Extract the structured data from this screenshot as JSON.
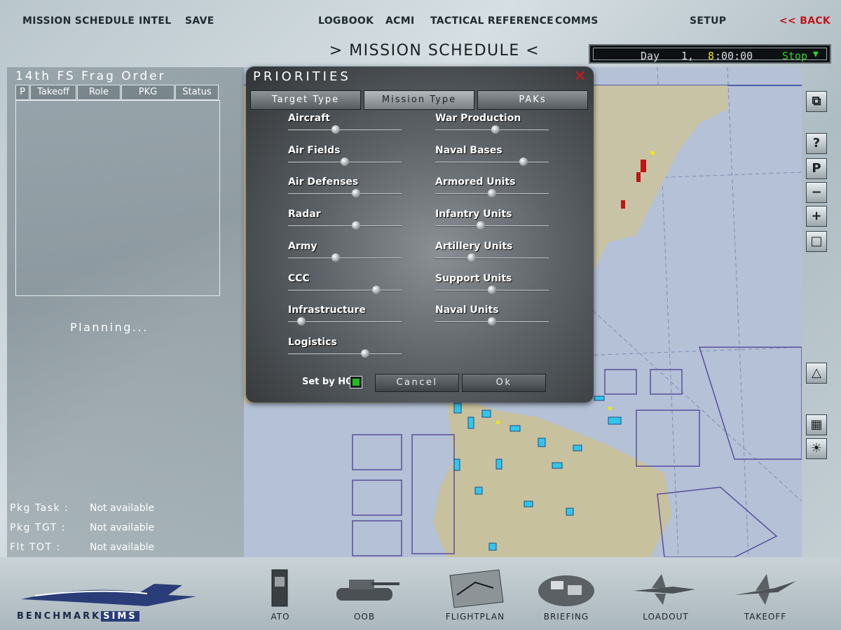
{
  "menu": {
    "mission_schedule": "MISSION SCHEDULE",
    "intel": "INTEL",
    "save": "SAVE",
    "logbook": "LOGBOOK",
    "acmi": "ACMI",
    "tactical_reference": "TACTICAL REFERENCE",
    "comms": "COMMS",
    "setup": "SETUP",
    "back": "<< BACK"
  },
  "page_title": "> MISSION SCHEDULE <",
  "clock": {
    "day_label": "Day",
    "day_value": "1,",
    "hour_digit": "8",
    "time_rest": ":00:00",
    "speed": "Stop"
  },
  "left_panel": {
    "title": "14th FS Frag Order",
    "columns": [
      "P",
      "Takeoff",
      "Role",
      "PKG",
      "Status"
    ],
    "planning_text": "Planning...",
    "info": [
      {
        "label": "Pkg Task :",
        "value": "Not available"
      },
      {
        "label": "Pkg TGT  :",
        "value": "Not available"
      },
      {
        "label": "Flt TOT  :",
        "value": "Not available"
      }
    ]
  },
  "dialog": {
    "title": "PRIORITIES",
    "tabs": [
      "Target Type",
      "Mission Type",
      "PAKs"
    ],
    "active_tab": 1,
    "left_items": [
      {
        "label": "Aircraft",
        "level": 0.42
      },
      {
        "label": "Air Fields",
        "level": 0.5
      },
      {
        "label": "Air Defenses",
        "level": 0.6
      },
      {
        "label": "Radar",
        "level": 0.6
      },
      {
        "label": "Army",
        "level": 0.42
      },
      {
        "label": "CCC",
        "level": 0.78
      },
      {
        "label": "Infrastructure",
        "level": 0.12
      },
      {
        "label": "Logistics",
        "level": 0.68
      }
    ],
    "right_items": [
      {
        "label": "War Production",
        "level": 0.53
      },
      {
        "label": "Naval Bases",
        "level": 0.78
      },
      {
        "label": "Armored Units",
        "level": 0.5
      },
      {
        "label": "Infantry Units",
        "level": 0.4
      },
      {
        "label": "Artillery Units",
        "level": 0.32
      },
      {
        "label": "Support Units",
        "level": 0.5
      },
      {
        "label": "Naval Units",
        "level": 0.5
      }
    ],
    "set_by_hq_label": "Set by HQ",
    "set_by_hq_checked": true,
    "cancel": "Cancel",
    "ok": "Ok"
  },
  "bottom_nav": [
    "ATO",
    "OOB",
    "FLIGHTPLAN",
    "BRIEFING",
    "LOADOUT",
    "TAKEOFF"
  ],
  "logo": {
    "part1": "BENCHMARK",
    "part2": "SIMS"
  },
  "colors": {
    "back": "#c0141a",
    "clock_green": "#2ed52e",
    "clock_yellow": "#f2e01a",
    "close_red": "#d0161d"
  }
}
